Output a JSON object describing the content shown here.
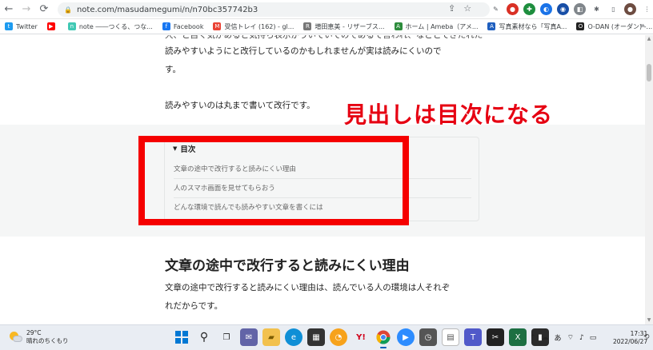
{
  "browser": {
    "url": "note.com/masudamegumi/n/n70bc357742b3",
    "bookmarks": [
      {
        "label": "Twitter",
        "color": "#1d9bf0",
        "glyph": "t"
      },
      {
        "label": "",
        "color": "#ff0000",
        "glyph": "▶"
      },
      {
        "label": "note ――つくる、つな...",
        "color": "#41c9b4",
        "glyph": "n"
      },
      {
        "label": "Facebook",
        "color": "#1877f2",
        "glyph": "f"
      },
      {
        "label": "受信トレイ (162) - gl...",
        "color": "#ea4335",
        "glyph": "M"
      },
      {
        "label": "増田恵美 - リザーブス...",
        "color": "#777777",
        "glyph": "R"
      },
      {
        "label": "ホーム | Ameba（アメ...",
        "color": "#2d8c3c",
        "glyph": "A"
      },
      {
        "label": "写真素材なら「写真A...",
        "color": "#1f5fbf",
        "glyph": "A"
      },
      {
        "label": "O-DAN (オーダン) -...",
        "color": "#222222",
        "glyph": "O"
      },
      {
        "label": "",
        "color": "#5f6368",
        "glyph": "◍"
      }
    ],
    "more_label": "»"
  },
  "article": {
    "line_top_partial": "大、と自く気があると気持ち表示がういていてのであるて言われ、などとてきたれた",
    "para1_line1": "読みやすいようにと改行しているのかもしれませんが実は読みにくいので",
    "para1_line2": "す。",
    "para2": "読みやすいのは丸まで書いて改行です。",
    "toc": {
      "title": "目次",
      "items": [
        "文章の途中で改行すると読みにくい理由",
        "人のスマホ画面を見せてもらおう",
        "どんな環境で読んでも読みやすい文章を書くには"
      ]
    },
    "annotation": "見出しは目次になる",
    "heading": "文章の途中で改行すると読みにくい理由",
    "para3_line1": "文章の途中で改行すると読みにくい理由は、読んでいる人の環境は人それぞ",
    "para3_line2": "れだからです。"
  },
  "taskbar": {
    "temperature": "29°C",
    "weather": "晴れのちくもり",
    "ime": "あ",
    "time": "17:31",
    "date": "2022/06/27"
  },
  "colors": {
    "annotation_red": "#e60012",
    "highlight_border": "#f50000"
  }
}
